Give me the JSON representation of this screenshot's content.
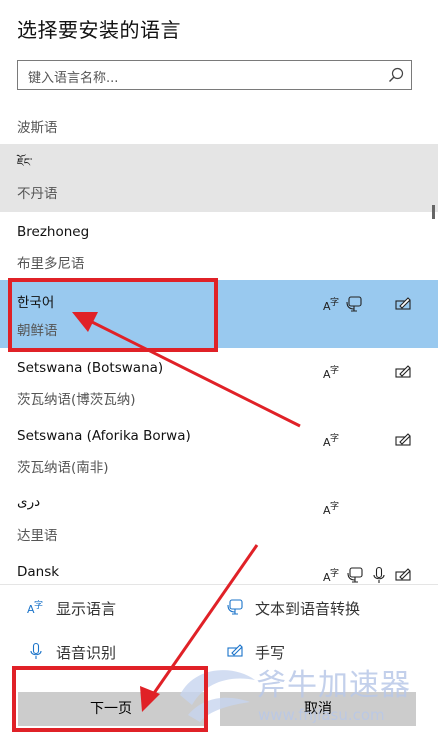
{
  "header": {
    "title": "选择要安装的语言"
  },
  "search": {
    "placeholder": "键入语言名称..."
  },
  "languages": [
    {
      "name": "",
      "native": "波斯语"
    },
    {
      "name": "ཇོང་",
      "native": "不丹语"
    },
    {
      "name": "Brezhoneg",
      "native": "布里多尼语"
    },
    {
      "name": "한국어",
      "native": "朝鲜语"
    },
    {
      "name": "Setswana (Botswana)",
      "native": "茨瓦纳语(博茨瓦纳)"
    },
    {
      "name": "Setswana (Aforika Borwa)",
      "native": "茨瓦纳语(南非)"
    },
    {
      "name": "دری",
      "native": "达里语"
    },
    {
      "name": "Dansk",
      "native": ""
    }
  ],
  "legend": {
    "display": "显示语言",
    "tts": "文本到语音转换",
    "speech": "语音识别",
    "handwriting": "手写"
  },
  "buttons": {
    "next": "下一页",
    "cancel": "取消"
  },
  "watermark": {
    "text": "斧牛加速器",
    "url": "www.fnjiasu.com"
  },
  "colors": {
    "selected_bg": "#99c9ef",
    "hover_bg": "#e5e5e5",
    "annotation": "#e02127",
    "icon_blue": "#1a73c9"
  }
}
